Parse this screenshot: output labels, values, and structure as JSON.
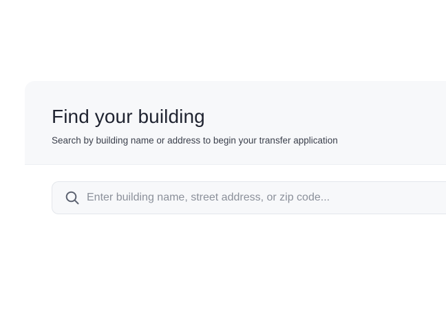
{
  "finder": {
    "title": "Find your building",
    "subtitle": "Search by building name or address to begin your transfer application"
  },
  "search": {
    "placeholder": "Enter building name, street address, or zip code...",
    "value": "",
    "icon": "search-icon"
  },
  "colors": {
    "header_bg": "#f7f8fa",
    "title_text": "#1f2330",
    "placeholder_text": "#8b909a",
    "border": "#e3e6eb"
  }
}
